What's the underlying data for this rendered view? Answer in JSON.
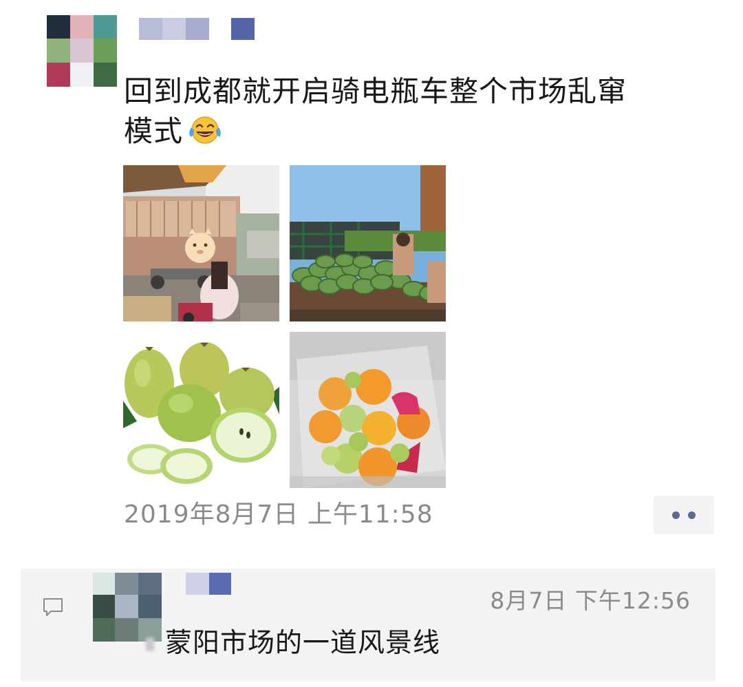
{
  "post": {
    "text_line1": "回到成都就开启骑电瓶车整个市场乱窜",
    "text_line2": "模式",
    "emoji": "face-with-tears-of-joy-icon",
    "timestamp": "2019年8月7日 上午11:58",
    "more_icon": "more-dots-icon",
    "photos": [
      {
        "subject": "market-truck-photo"
      },
      {
        "subject": "watermelon-truck-photo"
      },
      {
        "subject": "guava-photo"
      },
      {
        "subject": "fruit-box-photo"
      }
    ]
  },
  "comment": {
    "icon": "comment-icon",
    "time": "8月7日 下午12:56",
    "text": "蒙阳市场的一道风景线"
  },
  "colors": {
    "text_primary": "#181818",
    "text_secondary": "#8a8a8a",
    "comment_bg": "#f3f3f5",
    "link_blue": "#5a6b8c"
  }
}
